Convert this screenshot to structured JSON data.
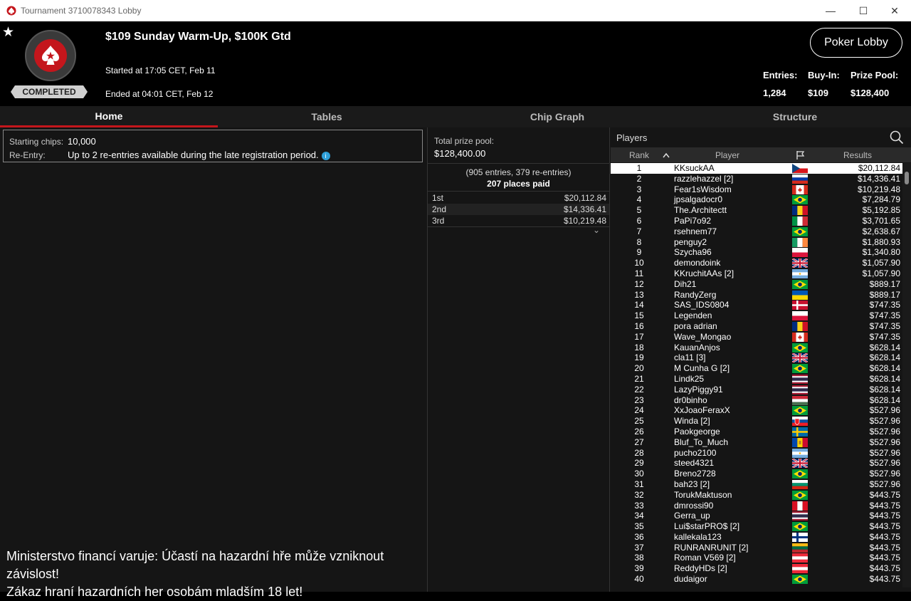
{
  "window": {
    "title": "Tournament 3710078343 Lobby"
  },
  "header": {
    "status": "COMPLETED",
    "name": "$109 Sunday Warm-Up, $100K Gtd",
    "started": "Started at 17:05 CET, Feb 11",
    "ended": "Ended at 04:01 CET, Feb 12",
    "lobby_button": "Poker Lobby",
    "entries_label": "Entries:",
    "entries_value": "1,284",
    "buyin_label": "Buy-In:",
    "buyin_value": "$109",
    "pool_label": "Prize Pool:",
    "pool_value": "$128,400"
  },
  "tabs": [
    "Home",
    "Tables",
    "Chip Graph",
    "Structure"
  ],
  "info": {
    "chips_label": "Starting chips:",
    "chips_value": "10,000",
    "reentry_label": "Re-Entry:",
    "reentry_value": "Up to 2 re-entries available during the late registration period."
  },
  "prize": {
    "label": "Total prize pool:",
    "value": "$128,400.00",
    "entries": "(905 entries, 379 re-entries)",
    "places": "207 places paid",
    "rows": [
      {
        "place": "1st",
        "amount": "$20,112.84"
      },
      {
        "place": "2nd",
        "amount": "$14,336.41"
      },
      {
        "place": "3rd",
        "amount": "$10,219.48"
      }
    ]
  },
  "warning": {
    "line1": "Ministerstvo financí varuje: Účastí na hazardní hře může vzniknout závislost!",
    "line2": "Zákaz hraní hazardních her osobám mladším 18 let!"
  },
  "players": {
    "title": "Players",
    "col_rank": "Rank",
    "col_player": "Player",
    "col_results": "Results",
    "rows": [
      {
        "rank": "1",
        "name": "KKsuckAA",
        "flag": "cz",
        "result": "$20,112.84"
      },
      {
        "rank": "2",
        "name": "razzlehazzel [2]",
        "flag": "ru",
        "result": "$14,336.41"
      },
      {
        "rank": "3",
        "name": "Fear1sWisdom",
        "flag": "ca",
        "result": "$10,219.48"
      },
      {
        "rank": "4",
        "name": "jpsalgadocr0",
        "flag": "br",
        "result": "$7,284.79"
      },
      {
        "rank": "5",
        "name": "The.Architectt",
        "flag": "ro",
        "result": "$5,192.85"
      },
      {
        "rank": "6",
        "name": "PaPi7o92",
        "flag": "it",
        "result": "$3,701.65"
      },
      {
        "rank": "7",
        "name": "rsehnem77",
        "flag": "br",
        "result": "$2,638.67"
      },
      {
        "rank": "8",
        "name": "penguy2",
        "flag": "ie",
        "result": "$1,880.93"
      },
      {
        "rank": "9",
        "name": "Szycha96",
        "flag": "pl",
        "result": "$1,340.80"
      },
      {
        "rank": "10",
        "name": "demondoink",
        "flag": "gb",
        "result": "$1,057.90"
      },
      {
        "rank": "11",
        "name": "KKruchitAAs [2]",
        "flag": "ar",
        "result": "$1,057.90"
      },
      {
        "rank": "12",
        "name": "Dih21",
        "flag": "br",
        "result": "$889.17"
      },
      {
        "rank": "13",
        "name": "RandyZerg",
        "flag": "ua",
        "result": "$889.17"
      },
      {
        "rank": "14",
        "name": "SAS_IDS0804",
        "flag": "dk",
        "result": "$747.35"
      },
      {
        "rank": "15",
        "name": "Legenden",
        "flag": "pl",
        "result": "$747.35"
      },
      {
        "rank": "16",
        "name": "pora adrian",
        "flag": "ro",
        "result": "$747.35"
      },
      {
        "rank": "17",
        "name": "Wave_Mongao",
        "flag": "ca",
        "result": "$747.35"
      },
      {
        "rank": "18",
        "name": "KauanAnjos",
        "flag": "br",
        "result": "$628.14"
      },
      {
        "rank": "19",
        "name": "cla11 [3]",
        "flag": "gb",
        "result": "$628.14"
      },
      {
        "rank": "20",
        "name": "M Cunha G [2]",
        "flag": "br",
        "result": "$628.14"
      },
      {
        "rank": "21",
        "name": "Lindk25",
        "flag": "th",
        "result": "$628.14"
      },
      {
        "rank": "22",
        "name": "LazyPiggy91",
        "flag": "th",
        "result": "$628.14"
      },
      {
        "rank": "23",
        "name": "dr0binho",
        "flag": "hu",
        "result": "$628.14"
      },
      {
        "rank": "24",
        "name": "XxJoaoFeraxX",
        "flag": "br",
        "result": "$527.96"
      },
      {
        "rank": "25",
        "name": "Winda [2]",
        "flag": "sk",
        "result": "$527.96"
      },
      {
        "rank": "26",
        "name": "Paokgeorge",
        "flag": "se",
        "result": "$527.96"
      },
      {
        "rank": "27",
        "name": "Bluf_To_Much",
        "flag": "md",
        "result": "$527.96"
      },
      {
        "rank": "28",
        "name": "pucho2100",
        "flag": "ar",
        "result": "$527.96"
      },
      {
        "rank": "29",
        "name": "steed4321",
        "flag": "gb",
        "result": "$527.96"
      },
      {
        "rank": "30",
        "name": "Breno2728",
        "flag": "br",
        "result": "$527.96"
      },
      {
        "rank": "31",
        "name": "bah23 [2]",
        "flag": "bg",
        "result": "$527.96"
      },
      {
        "rank": "32",
        "name": "TorukMaktuson",
        "flag": "br",
        "result": "$443.75"
      },
      {
        "rank": "33",
        "name": "dmrossi90",
        "flag": "pe",
        "result": "$443.75"
      },
      {
        "rank": "34",
        "name": "Gerra_up",
        "flag": "th",
        "result": "$443.75"
      },
      {
        "rank": "35",
        "name": "Lui$starPRO$ [2]",
        "flag": "br",
        "result": "$443.75"
      },
      {
        "rank": "36",
        "name": "kallekala123",
        "flag": "fi",
        "result": "$443.75"
      },
      {
        "rank": "37",
        "name": "RUNRANRUNIT [2]",
        "flag": "lt",
        "result": "$443.75"
      },
      {
        "rank": "38",
        "name": "Roman V569 [2]",
        "flag": "at",
        "result": "$443.75"
      },
      {
        "rank": "39",
        "name": "ReddyHDs [2]",
        "flag": "at",
        "result": "$443.75"
      },
      {
        "rank": "40",
        "name": "dudaigor",
        "flag": "br",
        "result": "$443.75"
      }
    ]
  },
  "colors": {
    "accent": "#c4161c",
    "background": "#000000",
    "panel": "#151515",
    "info_icon": "#2e9fd8"
  }
}
